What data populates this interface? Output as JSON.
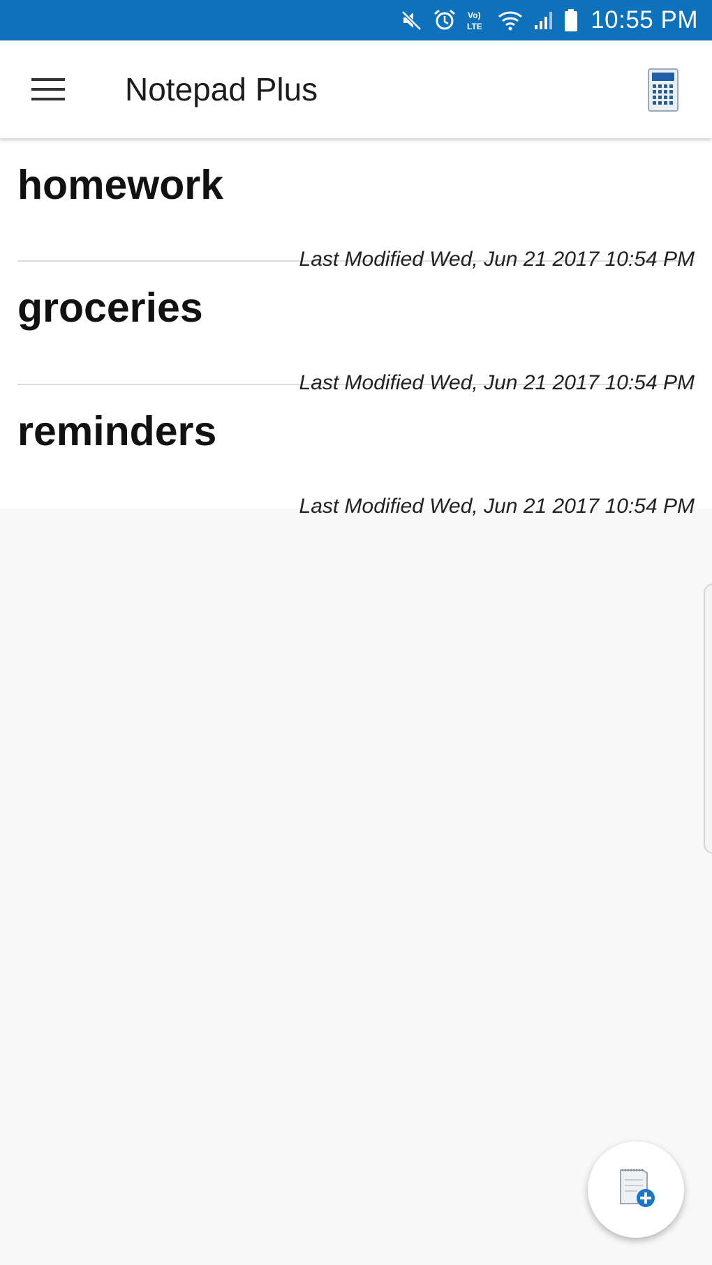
{
  "status_bar": {
    "time": "10:55 PM",
    "icons": [
      "mute-icon",
      "alarm-icon",
      "volte-icon",
      "wifi-icon",
      "signal-icon",
      "battery-icon"
    ],
    "volte_label": "Vo LTE",
    "background": "#0d71bb"
  },
  "app_bar": {
    "title": "Notepad Plus",
    "menu_icon": "hamburger-menu-icon",
    "action_icon": "calculator-icon"
  },
  "notes": [
    {
      "title": "homework",
      "modified": "Last Modified Wed, Jun 21 2017 10:54 PM"
    },
    {
      "title": "groceries",
      "modified": "Last Modified Wed, Jun 21 2017 10:54 PM"
    },
    {
      "title": "reminders",
      "modified": "Last Modified Wed, Jun 21 2017 10:54 PM"
    }
  ],
  "fab": {
    "icon": "new-note-icon",
    "accent": "#1976c8"
  }
}
